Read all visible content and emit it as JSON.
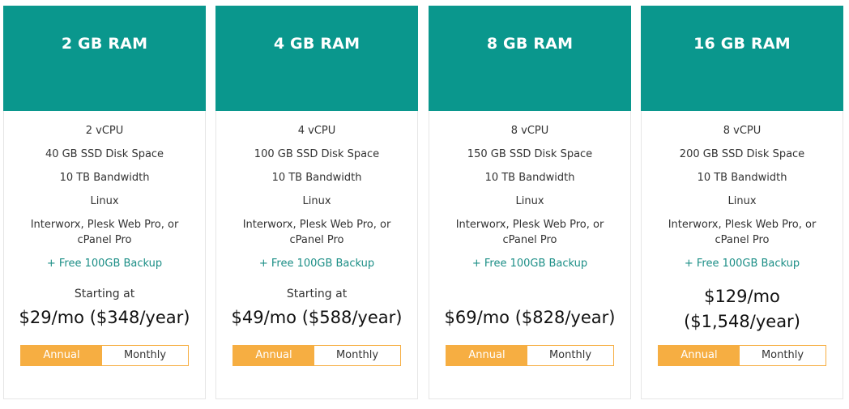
{
  "colors": {
    "header_bg": "#0a978d",
    "accent_orange": "#f6ae42",
    "backup_text": "#1b8e86"
  },
  "plans": [
    {
      "title": "2 GB RAM",
      "features": [
        "2 vCPU",
        "40 GB SSD Disk Space",
        "10 TB Bandwidth",
        "Linux",
        "Interworx, Plesk Web Pro, or cPanel Pro"
      ],
      "backup": "+ Free 100GB Backup",
      "starting_label": "Starting at",
      "price_monthly": "$29/mo",
      "price_yearly": "($348/year)",
      "toggle": {
        "annual": "Annual",
        "monthly": "Monthly",
        "selected": "Annual"
      }
    },
    {
      "title": "4 GB RAM",
      "features": [
        "4 vCPU",
        "100 GB SSD Disk Space",
        "10 TB Bandwidth",
        "Linux",
        "Interworx, Plesk Web Pro, or cPanel Pro"
      ],
      "backup": "+ Free 100GB Backup",
      "starting_label": "Starting at",
      "price_monthly": "$49/mo",
      "price_yearly": "($588/year)",
      "toggle": {
        "annual": "Annual",
        "monthly": "Monthly",
        "selected": "Annual"
      }
    },
    {
      "title": "8 GB RAM",
      "features": [
        "8 vCPU",
        "150 GB SSD Disk Space",
        "10 TB Bandwidth",
        "Linux",
        "Interworx, Plesk Web Pro, or cPanel Pro"
      ],
      "backup": "+ Free 100GB Backup",
      "starting_label": "",
      "price_monthly": "$69/mo",
      "price_yearly": "($828/year)",
      "toggle": {
        "annual": "Annual",
        "monthly": "Monthly",
        "selected": "Annual"
      }
    },
    {
      "title": "16 GB RAM",
      "features": [
        "8 vCPU",
        "200 GB SSD Disk Space",
        "10 TB Bandwidth",
        "Linux",
        "Interworx, Plesk Web Pro, or cPanel Pro"
      ],
      "backup": "+ Free 100GB Backup",
      "starting_label": "",
      "price_monthly": "$129/mo",
      "price_yearly": "($1,548/year)",
      "toggle": {
        "annual": "Annual",
        "monthly": "Monthly",
        "selected": "Annual"
      }
    }
  ]
}
